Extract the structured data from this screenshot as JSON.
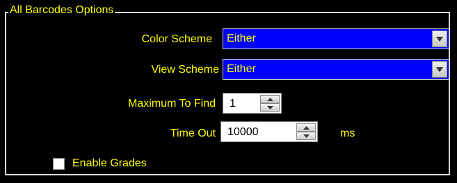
{
  "group": {
    "title": "All Barcodes Options"
  },
  "color_scheme": {
    "label": "Color Scheme",
    "value": "Either"
  },
  "view_scheme": {
    "label": "View Scheme",
    "value": "Either"
  },
  "maximum_to_find": {
    "label": "Maximum To Find",
    "value": "1"
  },
  "time_out": {
    "label": "Time Out",
    "value": "10000",
    "unit": "ms"
  },
  "enable_grades": {
    "label": "Enable Grades",
    "checked": false
  },
  "icons": {
    "dropdown": "chevron-down-icon",
    "spin_up": "arrow-up-icon",
    "spin_down": "arrow-down-icon"
  },
  "colors": {
    "background": "#000000",
    "text": "#ffff00",
    "combo_background": "#0000ff",
    "border": "#d9d9d9"
  }
}
